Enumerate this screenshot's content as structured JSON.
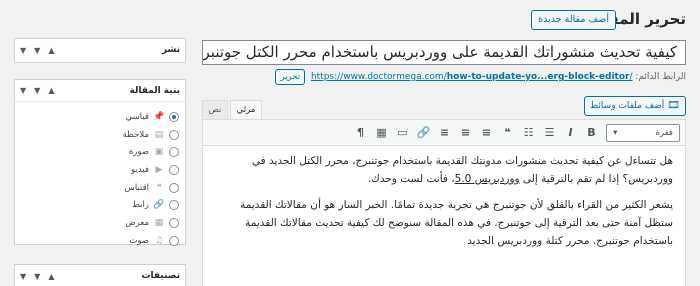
{
  "header": {
    "title": "تحرير المقالة",
    "add_new": "أضف مقالة جديدة"
  },
  "post": {
    "title": "كيفية تحديث منشوراتك القديمة على ووردبريس باستخدام محرر الكتل جوتنبرج",
    "permalink_label": "الرابط الدائم:",
    "permalink_base": "https://www.doctormega.com/",
    "permalink_slug": "how-to-update-yo...erg-block-editor",
    "permalink_end": "/",
    "edit_label": "تحرير"
  },
  "editor": {
    "add_media": "أضف ملفات وسائط",
    "tabs": {
      "visual": "مرئي",
      "text": "نص"
    },
    "format_select": "فقرة",
    "toolbar": [
      {
        "icon": "bold-icon",
        "glyph": "B"
      },
      {
        "icon": "italic-icon",
        "glyph": "I"
      },
      {
        "icon": "bullet-list-icon",
        "glyph": "☰"
      },
      {
        "icon": "numbered-list-icon",
        "glyph": "☷"
      },
      {
        "icon": "blockquote-icon",
        "glyph": "❝"
      },
      {
        "icon": "align-left-icon",
        "glyph": "≡"
      },
      {
        "icon": "align-center-icon",
        "glyph": "≡"
      },
      {
        "icon": "align-right-icon",
        "glyph": "≡"
      },
      {
        "icon": "link-icon",
        "glyph": "🔗"
      },
      {
        "icon": "more-tag-icon",
        "glyph": "▭"
      },
      {
        "icon": "toolbar-toggle-icon",
        "glyph": "▦"
      },
      {
        "icon": "paragraph-icon",
        "glyph": "¶"
      }
    ],
    "para1_a": "هل تتساءل عن كيفية تحديث منشورات مدونتك القديمة باستخدام جوتنبرج، محرر الكتل الجديد في ووردبريس؟ إذا لم تقم بالترقية إلى ",
    "para1_link": "ووردبريس 5.0",
    "para1_b": "، فأنت لست وحدك.",
    "para2": "يشعر الكثير من القراء بالقلق لأن جوتنبرج هي تجربة جديدة تمامًا. الخبر السار هو أن مقالاتك القديمة ستظل آمنة حتى بعد الترقية إلى جوتنبرج. في هذه المقالة سنوضح لك كيفية تحديث مقالاتك القديمة باستخدام جوتنبرج. محرر كتلة ووردبريس الجديد"
  },
  "sidebar": {
    "publish_title": "نشر",
    "format_title": "بنية المقالة",
    "categories_title": "تصنيفات",
    "arrows": {
      "up": "▲",
      "down": "▼",
      "toggle": "▼"
    },
    "formats": [
      {
        "label": "قياسي",
        "icon": "pin-icon",
        "glyph": "📌",
        "checked": true
      },
      {
        "label": "ملاحظة",
        "icon": "aside-icon",
        "glyph": "▤",
        "checked": false
      },
      {
        "label": "صورة",
        "icon": "image-icon",
        "glyph": "▣",
        "checked": false
      },
      {
        "label": "فيديو",
        "icon": "video-icon",
        "glyph": "▶",
        "checked": false
      },
      {
        "label": "اقتباس",
        "icon": "quote-icon",
        "glyph": "❝",
        "checked": false
      },
      {
        "label": "رابط",
        "icon": "link-icon",
        "glyph": "🔗",
        "checked": false
      },
      {
        "label": "معرض",
        "icon": "gallery-icon",
        "glyph": "▦",
        "checked": false
      },
      {
        "label": "صوت",
        "icon": "audio-icon",
        "glyph": "♫",
        "checked": false
      }
    ]
  }
}
